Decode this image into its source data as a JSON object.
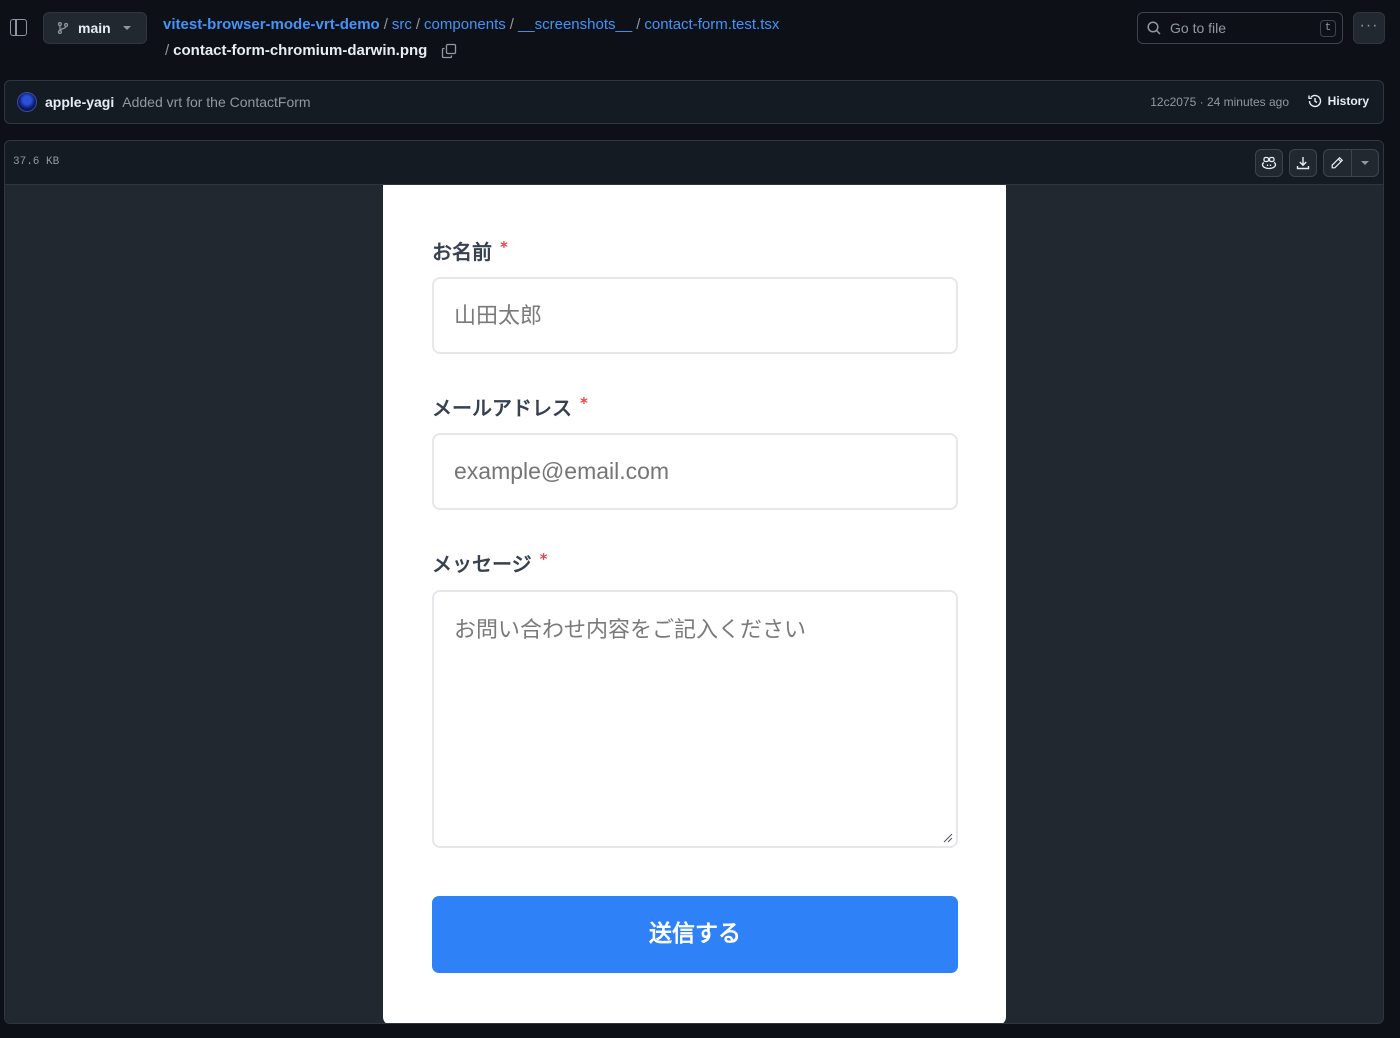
{
  "header": {
    "branch": "main",
    "breadcrumb": {
      "repo": "vitest-browser-mode-vrt-demo",
      "parts": [
        "src",
        "components",
        "__screenshots__",
        "contact-form.test.tsx"
      ],
      "separator": "/",
      "file": "contact-form-chromium-darwin.png"
    },
    "goto_file": {
      "label": "Go to file",
      "shortcut": "t"
    },
    "more": "···"
  },
  "commit": {
    "author": "apple-yagi",
    "message": "Added vrt for the ContactForm",
    "meta": "12c2075 · 24 minutes ago",
    "history_label": "History"
  },
  "file": {
    "size": "37.6 KB"
  },
  "form": {
    "name": {
      "label": "お名前",
      "required_mark": "*",
      "placeholder": "山田太郎"
    },
    "email": {
      "label": "メールアドレス",
      "required_mark": "*",
      "placeholder": "example@email.com"
    },
    "message": {
      "label": "メッセージ",
      "required_mark": "*",
      "placeholder": "お問い合わせ内容をご記入ください"
    },
    "submit_label": "送信する"
  },
  "colors": {
    "link": "#4493f8",
    "submit_button": "#2f81f7",
    "required": "#ef4444",
    "page_bg": "#0d1117",
    "image_bg": "#212830"
  },
  "icons": [
    "sidebar-toggle-icon",
    "git-branch-icon",
    "copy-icon",
    "search-icon",
    "kebab-icon",
    "history-icon",
    "copilot-icon",
    "download-icon",
    "pencil-icon",
    "chevron-down-icon",
    "resize-grip-icon"
  ]
}
